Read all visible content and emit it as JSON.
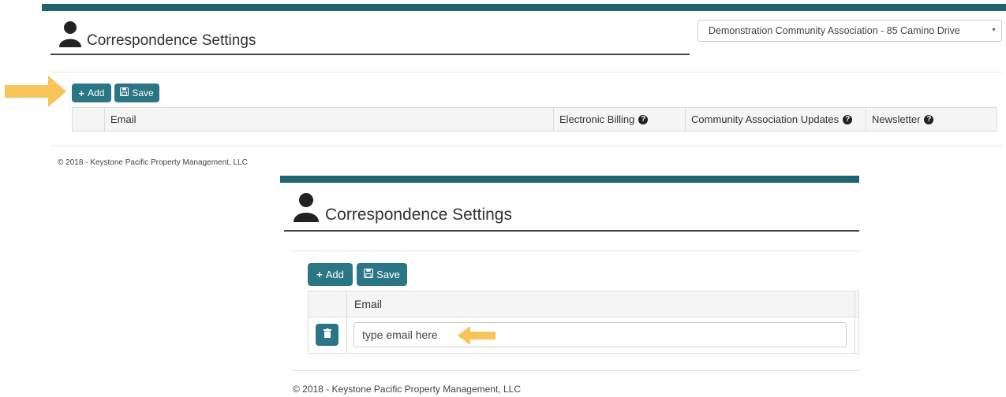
{
  "panel1": {
    "title": "Correspondence Settings",
    "community_select": "Demonstration Community Association - 85 Camino Drive",
    "add_label": "Add",
    "save_label": "Save",
    "columns": [
      "Email",
      "Electronic Billing",
      "Community Association Updates",
      "Newsletter"
    ],
    "footer": "© 2018 - Keystone Pacific Property Management, LLC"
  },
  "panel2": {
    "title": "Correspondence Settings",
    "add_label": "Add",
    "save_label": "Save",
    "columns": [
      "Email"
    ],
    "email_placeholder": "type email here",
    "footer": "© 2018 - Keystone Pacific Property Management, LLC"
  },
  "colors": {
    "brand": "#1f6470",
    "button": "#2a7685",
    "arrow": "#f7c45a"
  },
  "icons": [
    "user-icon",
    "plus-icon",
    "save-icon",
    "question-icon",
    "trash-icon",
    "chevron-down-icon",
    "arrow-right-icon",
    "arrow-left-icon"
  ]
}
